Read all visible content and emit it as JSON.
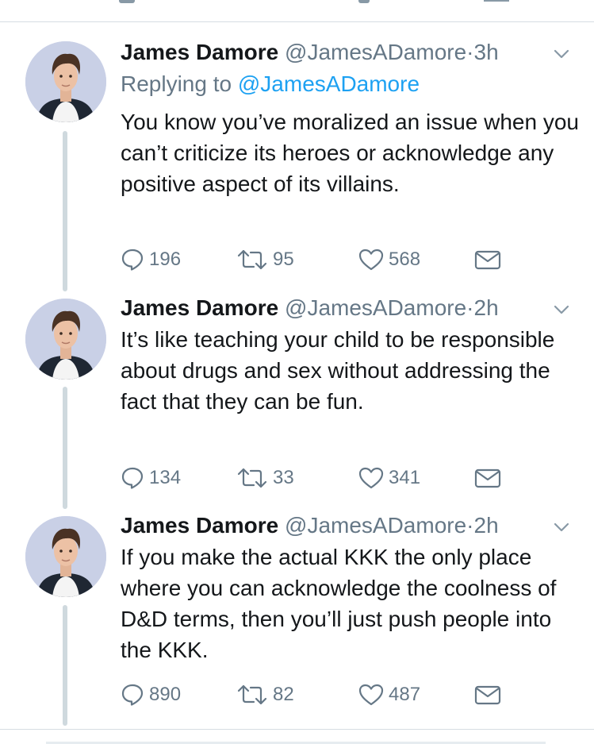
{
  "tweets": [
    {
      "name": "James Damore",
      "handle": "@JamesADamore",
      "separator": "·",
      "time": "3h",
      "reply_prefix": "Replying to",
      "reply_to": "@JamesADamore",
      "text": "You know you’ve moralized an issue when you can’t criticize its heroes or acknowledge any positive aspect of its villains.",
      "replies": "196",
      "retweets": "95",
      "likes": "568"
    },
    {
      "name": "James Damore",
      "handle": "@JamesADamore",
      "separator": "·",
      "time": "2h",
      "text": "It’s like teaching your child to be responsible about drugs and sex without addressing the fact that they can be fun.",
      "replies": "134",
      "retweets": "33",
      "likes": "341"
    },
    {
      "name": "James Damore",
      "handle": "@JamesADamore",
      "separator": "·",
      "time": "2h",
      "text": "If you make the actual KKK the only place where you can acknowledge the coolness of D&D terms, then you’ll just push people into the KKK.",
      "replies": "890",
      "retweets": "82",
      "likes": "487"
    }
  ],
  "icons": {
    "reply": "reply-icon",
    "retweet": "retweet-icon",
    "like": "heart-icon",
    "dm": "envelope-icon",
    "caret": "chevron-down-icon"
  },
  "colors": {
    "text": "#14171a",
    "secondary": "#657786",
    "link": "#1da1f2",
    "thread_line": "#cfd9de",
    "divider": "#d6dde3"
  }
}
